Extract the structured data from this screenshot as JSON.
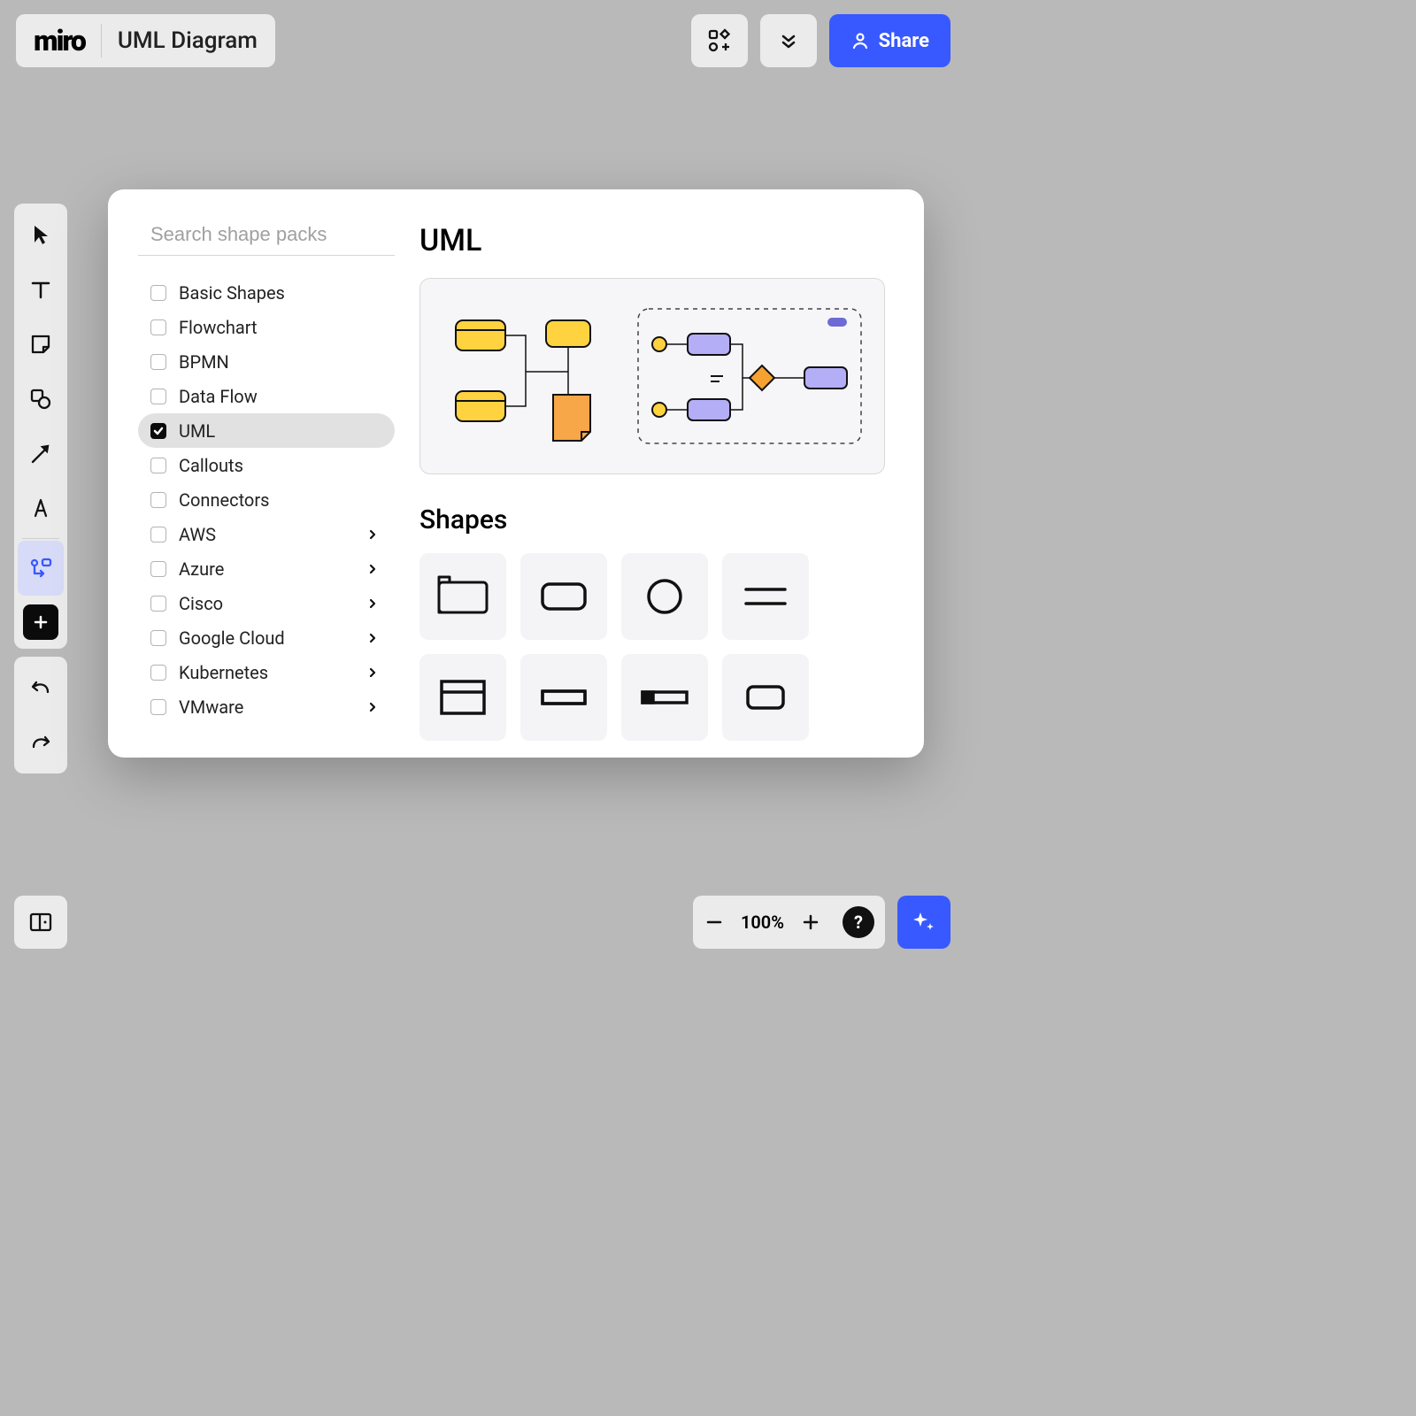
{
  "app": {
    "logo": "miro",
    "board_title": "UML Diagram"
  },
  "topright": {
    "share_label": "Share"
  },
  "zoom": {
    "level": "100%"
  },
  "dialog": {
    "search_placeholder": "Search shape packs",
    "title": "UML",
    "shapes_title": "Shapes",
    "packs": [
      {
        "label": "Basic Shapes",
        "checked": false,
        "expandable": false
      },
      {
        "label": "Flowchart",
        "checked": false,
        "expandable": false
      },
      {
        "label": "BPMN",
        "checked": false,
        "expandable": false
      },
      {
        "label": "Data Flow",
        "checked": false,
        "expandable": false
      },
      {
        "label": "UML",
        "checked": true,
        "expandable": false,
        "selected": true
      },
      {
        "label": "Callouts",
        "checked": false,
        "expandable": false
      },
      {
        "label": "Connectors",
        "checked": false,
        "expandable": false
      },
      {
        "label": "AWS",
        "checked": false,
        "expandable": true
      },
      {
        "label": "Azure",
        "checked": false,
        "expandable": true
      },
      {
        "label": "Cisco",
        "checked": false,
        "expandable": true
      },
      {
        "label": "Google Cloud",
        "checked": false,
        "expandable": true
      },
      {
        "label": "Kubernetes",
        "checked": false,
        "expandable": true
      },
      {
        "label": "VMware",
        "checked": false,
        "expandable": true
      }
    ],
    "shapes": [
      "uml-class",
      "uml-rounded-rect",
      "uml-circle",
      "uml-two-lines",
      "uml-header-rect",
      "uml-slot",
      "uml-slot-filled",
      "uml-small-rounded"
    ]
  }
}
